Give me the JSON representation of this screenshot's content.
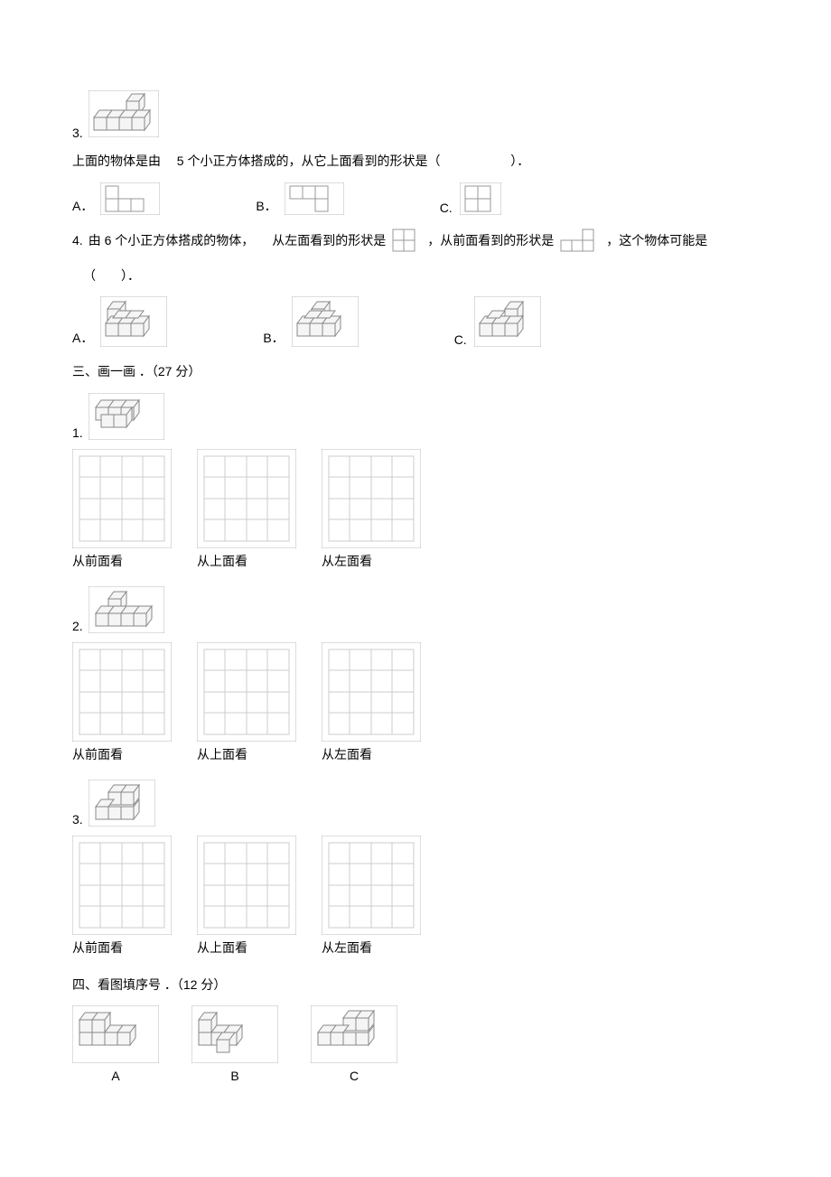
{
  "q3": {
    "num": "3.",
    "stem_a": "上面的物体是由",
    "stem_b": "5 个小正方体搭成的，从它上面看到的形状是（",
    "stem_c": "）．",
    "A": "A．",
    "B": "B．",
    "C": "C."
  },
  "q4": {
    "num": "4.",
    "stem_a": "由 6 个小正方体搭成的物体，",
    "stem_b": "从左面看到的形状是",
    "stem_c": "，从前面看到的形状是",
    "stem_d": "，这个物体可能是",
    "paren": "（　　）．",
    "A": "A．",
    "B": "B．",
    "C": "C."
  },
  "sec3": {
    "title": "三、画一画  ．（27 分）",
    "items": {
      "1": "1.",
      "2": "2.",
      "3": "3."
    },
    "labels": {
      "front": "从前面看",
      "top": "从上面看",
      "left": "从左面看"
    }
  },
  "sec4": {
    "title": "四、看图填序号   ．（12 分）",
    "A": "A",
    "B": "B",
    "C": "C"
  }
}
